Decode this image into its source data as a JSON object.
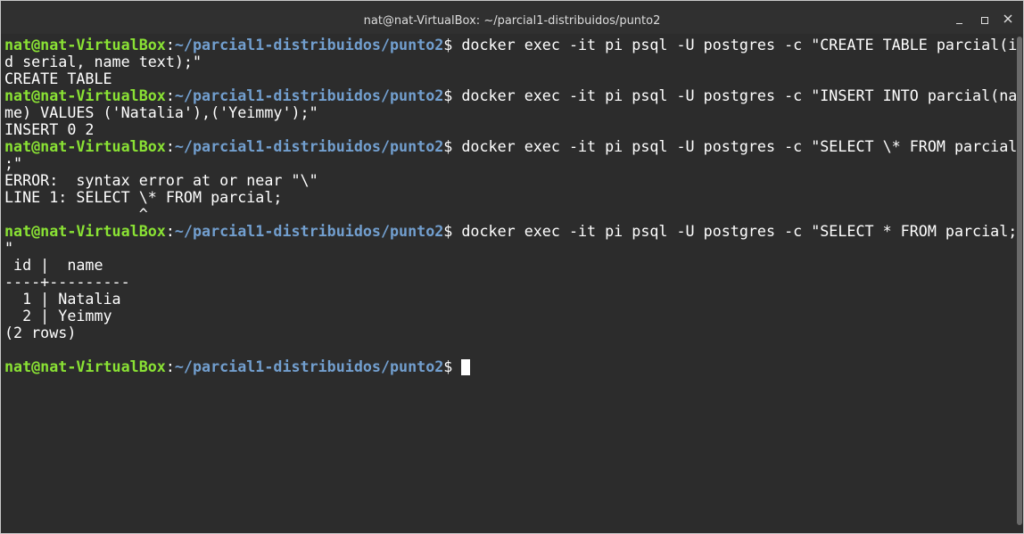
{
  "window": {
    "title": "nat@nat-VirtualBox: ~/parcial1-distribuidos/punto2"
  },
  "prompt": {
    "user_host": "nat@nat-VirtualBox",
    "colon": ":",
    "path": "~/parcial1-distribuidos/punto2",
    "dollar": "$"
  },
  "lines": [
    {
      "kind": "cmd",
      "text": " docker exec -it pi psql -U postgres -c \"CREATE TABLE parcial(i"
    },
    {
      "kind": "out",
      "text": "d serial, name text);\""
    },
    {
      "kind": "out",
      "text": "CREATE TABLE"
    },
    {
      "kind": "cmd",
      "text": " docker exec -it pi psql -U postgres -c \"INSERT INTO parcial(na"
    },
    {
      "kind": "out",
      "text": "me) VALUES ('Natalia'),('Yeimmy');\""
    },
    {
      "kind": "out",
      "text": "INSERT 0 2"
    },
    {
      "kind": "cmd",
      "text": " docker exec -it pi psql -U postgres -c \"SELECT \\* FROM parcial"
    },
    {
      "kind": "out",
      "text": ";\""
    },
    {
      "kind": "out",
      "text": "ERROR:  syntax error at or near \"\\\""
    },
    {
      "kind": "out",
      "text": "LINE 1: SELECT \\* FROM parcial;"
    },
    {
      "kind": "out",
      "text": "               ^"
    },
    {
      "kind": "cmd",
      "text": " docker exec -it pi psql -U postgres -c \"SELECT * FROM parcial;"
    },
    {
      "kind": "out",
      "text": "\""
    },
    {
      "kind": "out",
      "text": " id |  name"
    },
    {
      "kind": "out",
      "text": "----+---------"
    },
    {
      "kind": "out",
      "text": "  1 | Natalia"
    },
    {
      "kind": "out",
      "text": "  2 | Yeimmy"
    },
    {
      "kind": "out",
      "text": "(2 rows)"
    },
    {
      "kind": "out",
      "text": ""
    },
    {
      "kind": "prompt_cursor",
      "text": " "
    }
  ]
}
